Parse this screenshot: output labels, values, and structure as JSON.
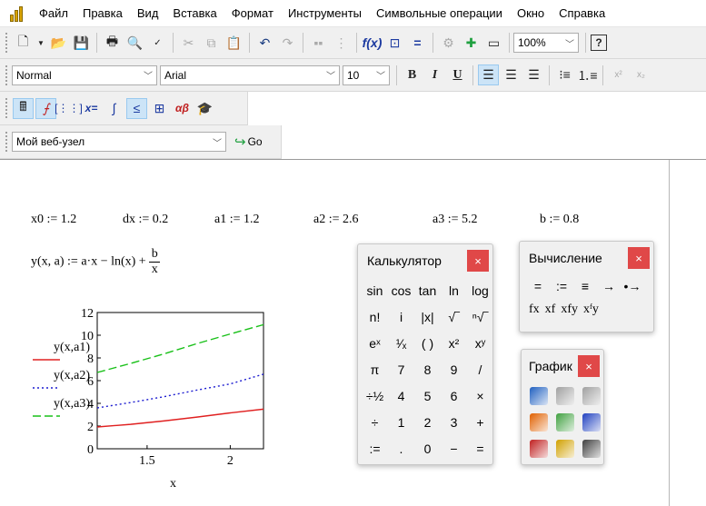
{
  "menu": [
    "Файл",
    "Правка",
    "Вид",
    "Вставка",
    "Формат",
    "Инструменты",
    "Символьные операции",
    "Окно",
    "Справка"
  ],
  "toolbar": {
    "zoom": "100%",
    "style": "Normal",
    "font": "Arial",
    "size": "10",
    "bold": "B",
    "italic": "I",
    "underline": "U",
    "help": "?"
  },
  "mathbar": {
    "xeq": "x=",
    "alpha_beta": "αβ"
  },
  "web": {
    "address": "Мой веб-узел",
    "go": "Go"
  },
  "worksheet": {
    "defs": [
      "x0 := 1.2",
      "dx := 0.2",
      "a1 := 1.2",
      "a2 := 2.6",
      "a3 := 5.2",
      "b := 0.8"
    ],
    "func_lhs": "y(x, a) := a·x − ln(x) +",
    "func_num": "b",
    "func_den": "x"
  },
  "chart_data": {
    "type": "line",
    "xlabel": "x",
    "x_ticks": [
      "1.5",
      "2"
    ],
    "y_ticks": [
      "0",
      "2",
      "4",
      "6",
      "8",
      "10",
      "12"
    ],
    "xlim": [
      1.2,
      2.2
    ],
    "ylim": [
      0,
      12
    ],
    "series": [
      {
        "name": "y(x,a1)",
        "color": "#e02020",
        "style": "solid",
        "x": [
          1.2,
          1.4,
          1.6,
          1.8,
          2.0,
          2.2
        ],
        "values": [
          1.92,
          2.15,
          2.45,
          2.79,
          3.16,
          3.49
        ]
      },
      {
        "name": "y(x,a2)",
        "color": "#1c1cd0",
        "style": "dotted",
        "x": [
          1.2,
          1.4,
          1.6,
          1.8,
          2.0,
          2.2
        ],
        "values": [
          3.6,
          4.07,
          4.58,
          5.17,
          5.71,
          6.57
        ]
      },
      {
        "name": "y(x,a3)",
        "color": "#18c018",
        "style": "dashed",
        "x": [
          1.2,
          1.4,
          1.6,
          1.8,
          2.0,
          2.2
        ],
        "values": [
          6.72,
          7.51,
          8.35,
          9.26,
          10.11,
          10.93
        ]
      }
    ]
  },
  "calculator": {
    "title": "Калькулятор",
    "close": "×",
    "keys": [
      "sin",
      "cos",
      "tan",
      "ln",
      "log",
      "n!",
      "i",
      "|x|",
      "√‾",
      "ⁿ√‾",
      "eˣ",
      "¹⁄ₓ",
      "( )",
      "x²",
      "xʸ",
      "π",
      "7",
      "8",
      "9",
      "/",
      "÷½",
      "4",
      "5",
      "6",
      "×",
      "÷",
      "1",
      "2",
      "3",
      "+",
      ":=",
      ".",
      "0",
      "−",
      "="
    ]
  },
  "evaluation": {
    "title": "Вычисление",
    "close": "×",
    "row1": [
      "=",
      ":=",
      "≡",
      "→",
      "•→"
    ],
    "row2": [
      "fx",
      "xf",
      "xfy",
      "xᶠy"
    ]
  },
  "graph": {
    "title": "График",
    "close": "×",
    "icons": [
      "xy-plot-icon",
      "polar-plot-icon",
      "surface-plot-icon",
      "3d-scatter-icon",
      "contour-plot-icon",
      "vector-field-icon",
      "bar-3d-icon",
      "zoom-icon",
      "trace-icon"
    ],
    "colors": [
      "#2060c0",
      "#a0a0a0",
      "#a0a0a0",
      "#e06000",
      "#40a040",
      "#2040c0",
      "#c02020",
      "#d0a000",
      "#404040"
    ]
  }
}
